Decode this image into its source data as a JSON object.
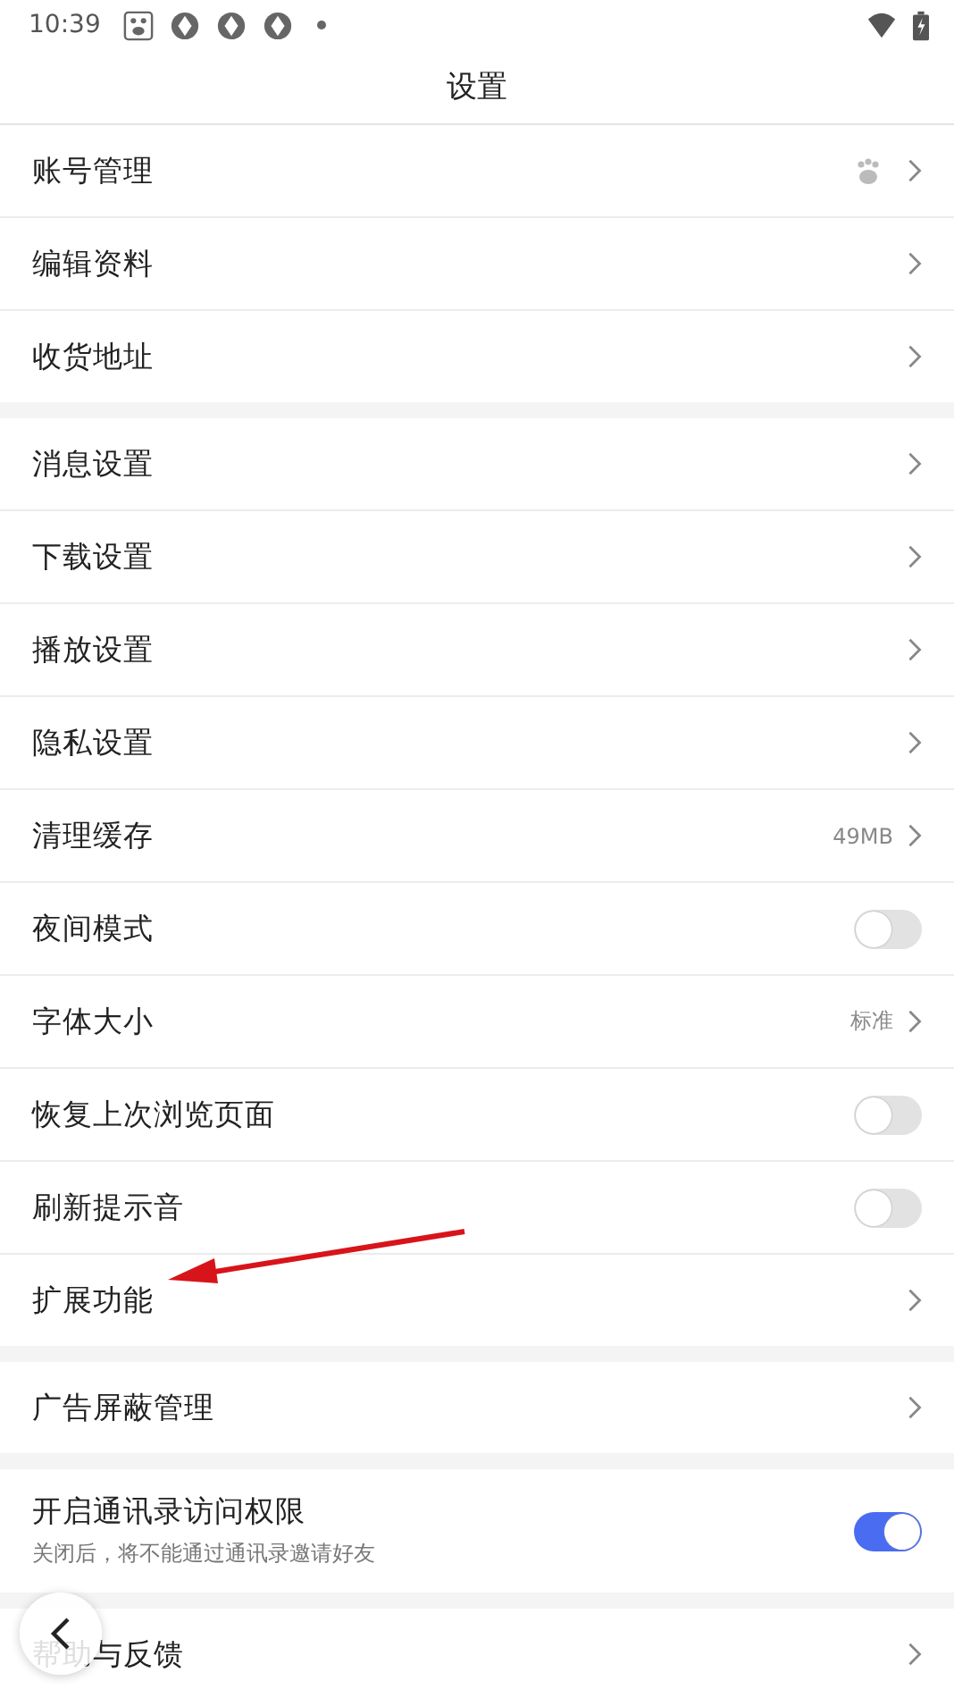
{
  "status_bar": {
    "time": "10:39"
  },
  "title": "设置",
  "sections": [
    {
      "items": [
        {
          "kind": "link",
          "label": "账号管理",
          "icon": true
        },
        {
          "kind": "link",
          "label": "编辑资料"
        },
        {
          "kind": "link",
          "label": "收货地址"
        }
      ]
    },
    {
      "items": [
        {
          "kind": "link",
          "label": "消息设置"
        },
        {
          "kind": "link",
          "label": "下载设置"
        },
        {
          "kind": "link",
          "label": "播放设置"
        },
        {
          "kind": "link",
          "label": "隐私设置"
        },
        {
          "kind": "link",
          "label": "清理缓存",
          "value": "49MB"
        },
        {
          "kind": "toggle",
          "label": "夜间模式",
          "on": false
        },
        {
          "kind": "link",
          "label": "字体大小",
          "value": "标准"
        },
        {
          "kind": "toggle",
          "label": "恢复上次浏览页面",
          "on": false
        },
        {
          "kind": "toggle",
          "label": "刷新提示音",
          "on": false
        },
        {
          "kind": "link",
          "label": "扩展功能"
        }
      ]
    },
    {
      "items": [
        {
          "kind": "link",
          "label": "广告屏蔽管理"
        }
      ]
    },
    {
      "items": [
        {
          "kind": "toggle",
          "label": "开启通讯录访问权限",
          "subtitle": "关闭后，将不能通过通讯录邀请好友",
          "on": true
        }
      ]
    },
    {
      "items": [
        {
          "kind": "link",
          "label": "帮助与反馈"
        }
      ]
    }
  ]
}
